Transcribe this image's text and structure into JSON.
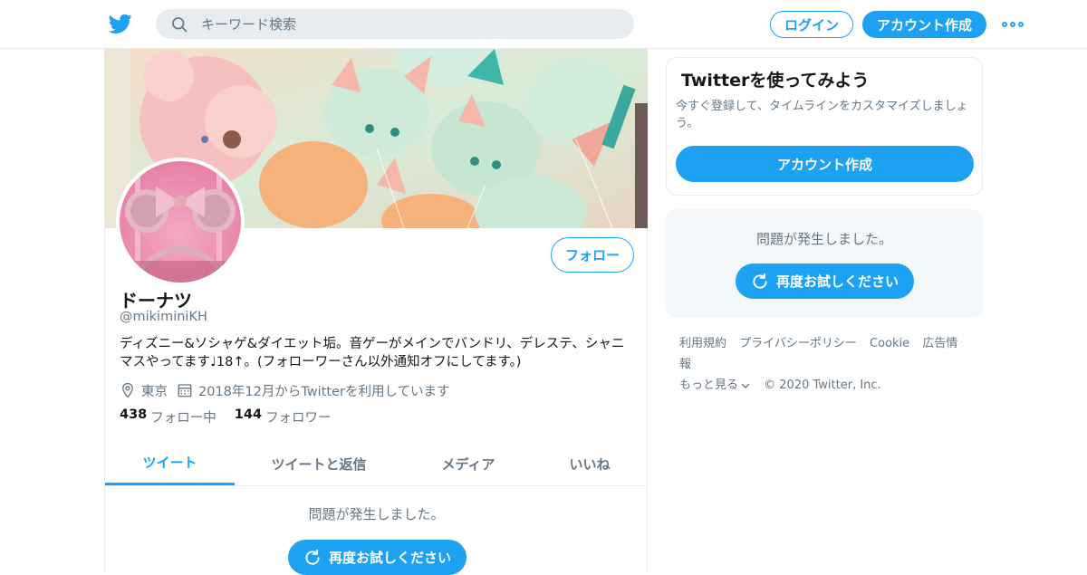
{
  "nav": {
    "search_placeholder": "キーワード検索",
    "login_label": "ログイン",
    "signup_label": "アカウント作成"
  },
  "profile": {
    "name": "ドーナツ",
    "handle": "@mikiminiKH",
    "bio": "ディズニー&ソシャゲ&ダイエット垢。音ゲーがメインでバンドリ、デレステ、シャニマスやってます♩18↑。(フォローワーさん以外通知オフにしてます。)",
    "location": "東京",
    "joined": "2018年12月からTwitterを利用しています",
    "follow_label": "フォロー",
    "following_count": "438",
    "following_label": "フォロー中",
    "followers_count": "144",
    "followers_label": "フォロワー"
  },
  "tabs": [
    {
      "label": "ツイート",
      "active": true
    },
    {
      "label": "ツイートと返信",
      "active": false
    },
    {
      "label": "メディア",
      "active": false
    },
    {
      "label": "いいね",
      "active": false
    }
  ],
  "timeline": {
    "error_text": "問題が発生しました。",
    "retry_label": "再度お試しください"
  },
  "sidebar": {
    "signup_card": {
      "title": "Twitterを使ってみよう",
      "description": "今すぐ登録して、タイムラインをカスタマイズしましょう。",
      "button_label": "アカウント作成"
    },
    "error_card": {
      "error_text": "問題が発生しました。",
      "retry_label": "再度お試しください"
    }
  },
  "footer": {
    "links": [
      "利用規約",
      "プライバシーポリシー",
      "Cookie",
      "広告情報"
    ],
    "more_label": "もっと見る",
    "copyright": "© 2020 Twitter, Inc."
  },
  "colors": {
    "accent": "#1da1f2",
    "text_primary": "#14171a",
    "text_secondary": "#657786",
    "border": "#e6ecf0",
    "panel_bg": "#f5f8fa"
  },
  "icons": [
    "twitter-bird-icon",
    "search-icon",
    "more-dots-icon",
    "location-pin-icon",
    "calendar-icon",
    "refresh-icon",
    "chevron-down-icon"
  ]
}
